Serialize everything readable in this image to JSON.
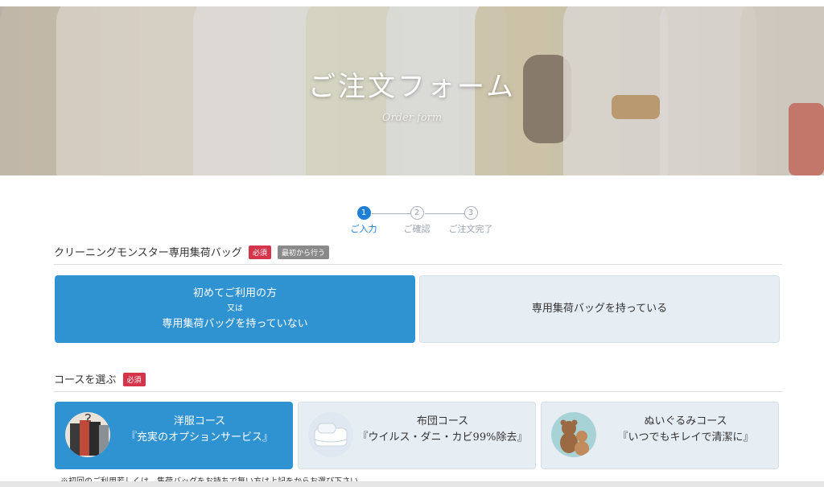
{
  "hero": {
    "title": "ご注文フォーム",
    "subtitle": "Order form"
  },
  "stepper": {
    "steps": [
      {
        "num": "1",
        "label": "ご入力"
      },
      {
        "num": "2",
        "label": "ご確認"
      },
      {
        "num": "3",
        "label": "ご注文完了"
      }
    ],
    "active_step": 1
  },
  "bag_section": {
    "title": "クリーニングモンスター専用集荷バッグ",
    "required_badge": "必須",
    "restart_badge": "最初から行う",
    "option_first": {
      "line1": "初めてご利用の方",
      "line2": "又は",
      "line3": "専用集荷バッグを持っていない"
    },
    "option_have": {
      "label": "専用集荷バッグを持っている"
    },
    "selected": "option_first"
  },
  "course_section": {
    "title": "コースを選ぶ",
    "required_badge": "必須",
    "courses": [
      {
        "title": "洋服コース",
        "subtitle": "『充実のオプションサービス』",
        "icon": "clothes-thumb"
      },
      {
        "title": "布団コース",
        "subtitle": "『ウイルス・ダニ・カビ99%除去』",
        "icon": "futon-thumb"
      },
      {
        "title": "ぬいぐるみコース",
        "subtitle": "『いつでもキレイで清潔に』",
        "icon": "plush-thumb"
      }
    ],
    "selected_index": 0
  },
  "note": "※初回のご利用若しくは、集荷バッグをお持ちで無い方は上記をからお選び下さい",
  "colors": {
    "accent": "#1f7fd6",
    "selected_card": "#2f93d1",
    "card_bg": "#e7eef3",
    "required_badge": "#d6344a",
    "restart_badge": "#8a8a8a"
  }
}
